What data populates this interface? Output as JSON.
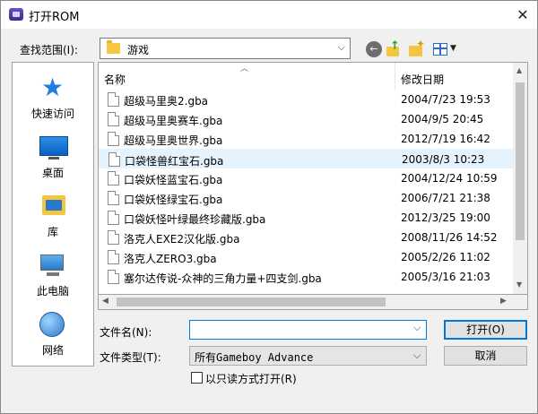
{
  "window": {
    "title": "打开ROM",
    "close_glyph": "✕"
  },
  "lookin": {
    "label": "查找范围(I):",
    "value": "游戏"
  },
  "places": [
    {
      "label": "快速访问",
      "icon": "quick-access-icon"
    },
    {
      "label": "桌面",
      "icon": "desktop-icon"
    },
    {
      "label": "库",
      "icon": "library-icon"
    },
    {
      "label": "此电脑",
      "icon": "this-pc-icon"
    },
    {
      "label": "网络",
      "icon": "network-icon"
    }
  ],
  "filelist": {
    "columns": {
      "name": "名称",
      "date": "修改日期"
    },
    "files": [
      {
        "name": "超级马里奥2.gba",
        "date": "2004/7/23 19:53"
      },
      {
        "name": "超级马里奥赛车.gba",
        "date": "2004/9/5 20:45"
      },
      {
        "name": "超级马里奥世界.gba",
        "date": "2012/7/19 16:42"
      },
      {
        "name": "口袋怪兽红宝石.gba",
        "date": "2003/8/3 10:23"
      },
      {
        "name": "口袋妖怪蓝宝石.gba",
        "date": "2004/12/24 10:59"
      },
      {
        "name": "口袋妖怪绿宝石.gba",
        "date": "2006/7/21 21:38"
      },
      {
        "name": "口袋妖怪叶绿最终珍藏版.gba",
        "date": "2012/3/25 19:00"
      },
      {
        "name": "洛克人EXE2汉化版.gba",
        "date": "2008/11/26 14:52"
      },
      {
        "name": "洛克人ZERO3.gba",
        "date": "2005/2/26 11:02"
      },
      {
        "name": "塞尔达传说-众神的三角力量+四支剑.gba",
        "date": "2005/3/16 21:03"
      }
    ]
  },
  "filename": {
    "label": "文件名(N):",
    "value": ""
  },
  "filetype": {
    "label": "文件类型(T):",
    "value": "所有Gameboy Advance"
  },
  "buttons": {
    "open": "打开(O)",
    "cancel": "取消"
  },
  "readonly": {
    "label": "以只读方式打开(R)"
  },
  "colors": {
    "selection": "#e5f3ff",
    "accent": "#0078d7"
  }
}
